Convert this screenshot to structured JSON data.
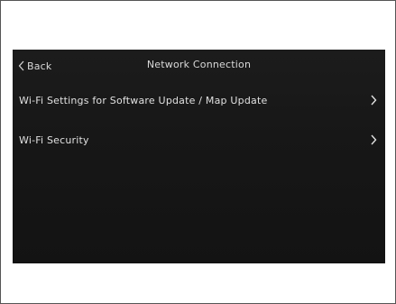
{
  "header": {
    "back_label": "Back",
    "title": "Network Connection"
  },
  "menu": {
    "items": [
      {
        "label": "Wi-Fi Settings for Software Update / Map Update",
        "icon": "chevron-right-icon"
      },
      {
        "label": "Wi-Fi Security",
        "icon": "chevron-right-icon"
      }
    ]
  },
  "colors": {
    "screen_background": "#181818",
    "text": "#e0e0e0"
  }
}
